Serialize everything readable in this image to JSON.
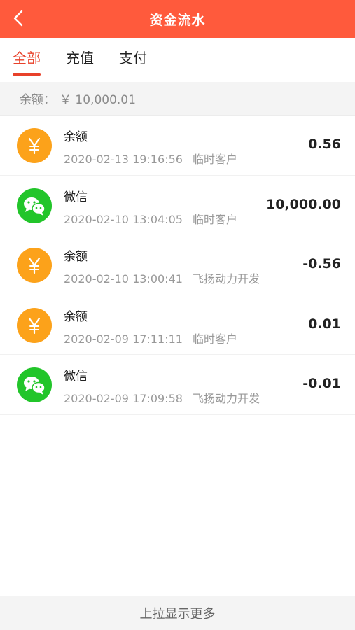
{
  "header": {
    "title": "资金流水",
    "back_icon": "chevron-left-icon",
    "color": "#ff5a3c"
  },
  "tabs": [
    {
      "label": "全部",
      "active": true
    },
    {
      "label": "充值",
      "active": false
    },
    {
      "label": "支付",
      "active": false
    }
  ],
  "balance": {
    "label": "余额：",
    "value": "￥ 10,000.01"
  },
  "transactions": [
    {
      "icon": "yuan-icon",
      "name": "余额",
      "time": "2020-02-13 19:16:56",
      "customer": "临时客户",
      "amount": "0.56"
    },
    {
      "icon": "wechat-icon",
      "name": "微信",
      "time": "2020-02-10 13:04:05",
      "customer": "临时客户",
      "amount": "10,000.00"
    },
    {
      "icon": "yuan-icon",
      "name": "余额",
      "time": "2020-02-10 13:00:41",
      "customer": "飞扬动力开发",
      "amount": "-0.56"
    },
    {
      "icon": "yuan-icon",
      "name": "余额",
      "time": "2020-02-09 17:11:11",
      "customer": "临时客户",
      "amount": "0.01"
    },
    {
      "icon": "wechat-icon",
      "name": "微信",
      "time": "2020-02-09 17:09:58",
      "customer": "飞扬动力开发",
      "amount": "-0.01"
    }
  ],
  "footer": {
    "load_more": "上拉显示更多"
  },
  "colors": {
    "accent": "#e8412a",
    "yuan_icon": "#fca21a",
    "wechat_icon": "#22c52a"
  }
}
